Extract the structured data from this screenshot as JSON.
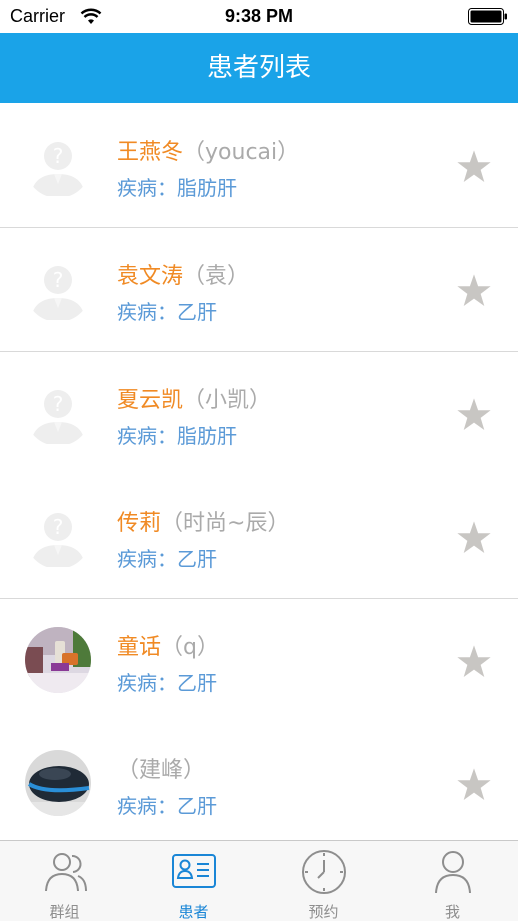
{
  "status_bar": {
    "carrier": "Carrier",
    "time": "9:38 PM"
  },
  "nav": {
    "title": "患者列表"
  },
  "patients": [
    {
      "name": "王燕冬",
      "nickname": "（youcai）",
      "disease": "疾病：脂肪肝",
      "avatar": "default-avatar-icon"
    },
    {
      "name": "袁文涛",
      "nickname": "（袁）",
      "disease": "疾病：乙肝",
      "avatar": "default-avatar-icon"
    },
    {
      "name": "夏云凯",
      "nickname": "（小凯）",
      "disease": "疾病：脂肪肝",
      "avatar": "default-avatar-icon"
    },
    {
      "name": "传莉",
      "nickname": "（时尚~辰）",
      "disease": "疾病：乙肝",
      "avatar": "default-avatar-icon"
    },
    {
      "name": "童话",
      "nickname": "（q）",
      "disease": "疾病：乙肝",
      "avatar": "photo-avatar"
    },
    {
      "name": "",
      "nickname": "（建峰）",
      "disease": "疾病：乙肝",
      "avatar": "photo-avatar"
    }
  ],
  "tabs": [
    {
      "label": "群组",
      "icon": "group-icon"
    },
    {
      "label": "患者",
      "icon": "patient-card-icon",
      "active": true
    },
    {
      "label": "预约",
      "icon": "clock-icon"
    },
    {
      "label": "我",
      "icon": "person-icon"
    }
  ],
  "colors": {
    "nav_background": "#1aa3e8",
    "name": "#f08a24",
    "nickname": "#aaaaaa",
    "disease": "#5b9ad7",
    "star": "#c8c6c3",
    "tab_active": "#1a86d6",
    "tab_inactive": "#8e8e8e"
  }
}
